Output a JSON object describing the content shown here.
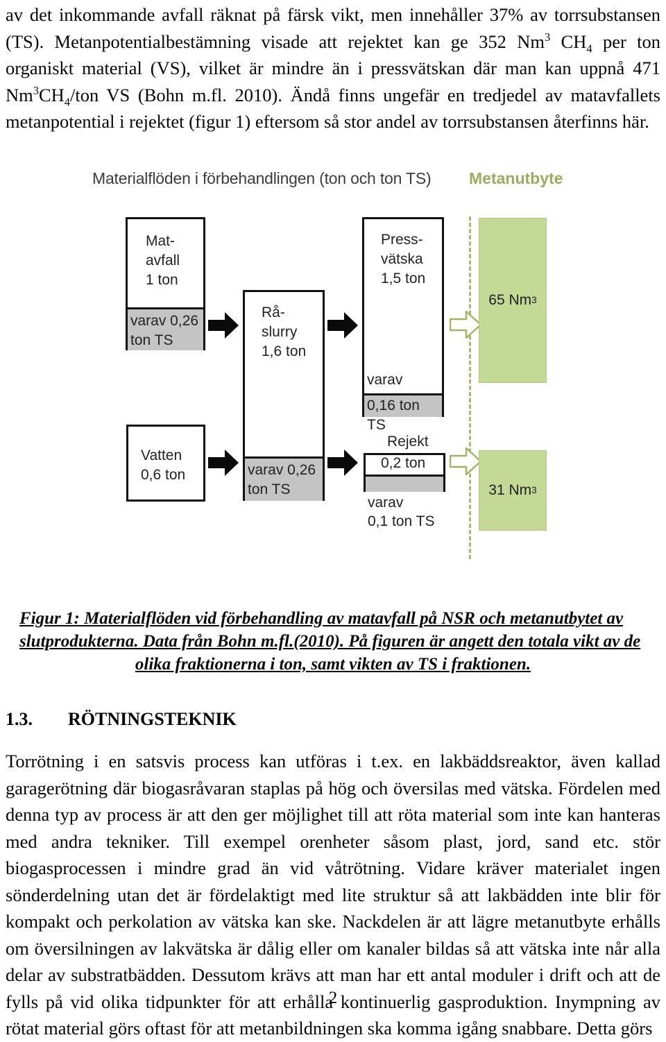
{
  "document": {
    "page_number": "2"
  },
  "intro_paragraph": {
    "line1": "av det inkommande avfall räknat på färsk vikt, men innehåller 37% av torrsubstansen",
    "line2_a": "(TS). Metanpotentialbestämning visade att rejektet kan ge 352 Nm",
    "line2_sup": "3",
    "line2_b": " CH",
    "line2_sub": "4",
    "line2_c": " per ton",
    "line3": "organiskt material (VS), vilket är mindre än i pressvätskan där man kan uppnå 471",
    "line4_a": "Nm",
    "line4_sup": "3",
    "line4_b": "CH",
    "line4_sub": "4",
    "line4_c": "/ton VS (Bohn m.fl. 2010). Ändå finns ungefär en tredjedel av matavfallets",
    "line5": "metanpotential i rejektet (figur 1) eftersom så stor andel av torrsubstansen återfinns här."
  },
  "figure": {
    "title_left": "Materialflöden i förbehandlingen (ton och ton TS)",
    "title_right": "Metanutbyte",
    "title_right_color": "#9aac5e",
    "green_fill": "#c4d995",
    "gray_fill": "#c4c4c4",
    "boxes": {
      "matavfall": {
        "main": "Mat-\navfall\n1 ton",
        "band": "varav 0,26\nton TS"
      },
      "raslurry": {
        "main": "Rå-\nslurry\n1,6 ton",
        "band": "varav 0,26\nton TS"
      },
      "vatten": {
        "main": "Vatten\n0,6 ton"
      },
      "pressvatska": {
        "main": "Press-\nvätska\n1,5 ton",
        "varav": "varav",
        "band": "0,16 ton TS"
      },
      "rejekt": {
        "label": "Rejekt",
        "main": "0,2 ton",
        "below": "varav\n0,1 ton TS"
      }
    },
    "yields": {
      "pressvatska_value": "65 Nm",
      "pressvatska_unit_sup": "3",
      "rejekt_value": "31 Nm",
      "rejekt_unit_sup": "3"
    }
  },
  "caption": {
    "line1": "Figur 1: Materialflöden vid förbehandling av matavfall på NSR och metanutbytet av",
    "line2": "slutprodukterna. Data från Bohn m.fl.(2010). På figuren är angett den totala vikt av de",
    "line3": "olika fraktionerna i ton, samt vikten av TS i fraktionen."
  },
  "section": {
    "number": "1.3.",
    "title": "RÖTNINGSTEKNIK",
    "body": "Torrötning i en satsvis process kan utföras i t.ex. en lakbäddsreaktor, även kallad garagerötning där biogasråvaran staplas på hög och översilas med vätska. Fördelen med denna typ av process är att den ger möjlighet till att röta material som inte kan hanteras med andra tekniker. Till exempel orenheter såsom plast, jord, sand etc. stör biogasprocessen i mindre grad än vid våtrötning. Vidare kräver materialet ingen sönderdelning utan det är fördelaktigt med lite struktur så att lakbädden inte blir för kompakt och perkolation av vätska kan ske. Nackdelen är att lägre metanutbyte erhålls om översilningen av lakvätska är dålig eller om kanaler bildas så att vätska inte når alla delar av substratbädden. Dessutom krävs att man har ett antal moduler i drift och att de fylls på vid olika tidpunkter för att erhålla kontinuerlig gasproduktion. Inympning av rötat material görs oftast för att metanbildningen ska komma igång snabbare. Detta görs"
  }
}
